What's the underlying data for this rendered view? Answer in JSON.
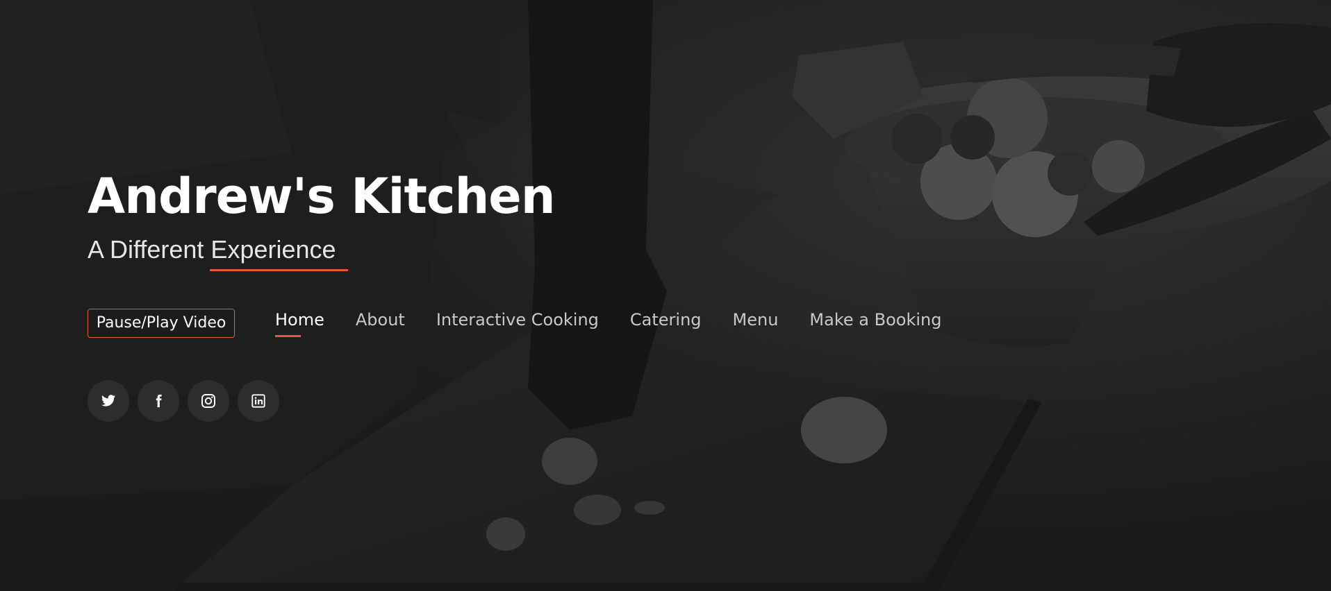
{
  "site": {
    "title": "Andrew's Kitchen",
    "tagline": "A Different Experience"
  },
  "controls": {
    "pause_play_label": "Pause/Play Video"
  },
  "nav": {
    "items": [
      {
        "label": "Home",
        "active": true
      },
      {
        "label": "About",
        "active": false
      },
      {
        "label": "Interactive Cooking",
        "active": false
      },
      {
        "label": "Catering",
        "active": false
      },
      {
        "label": "Menu",
        "active": false
      },
      {
        "label": "Make a Booking",
        "active": false
      }
    ]
  },
  "social": {
    "icons": [
      "twitter-icon",
      "facebook-icon",
      "instagram-icon",
      "linkedin-icon"
    ]
  },
  "colors": {
    "accent": "#e05a3f",
    "text": "#ffffff",
    "nav_text": "#c9c9c9"
  }
}
